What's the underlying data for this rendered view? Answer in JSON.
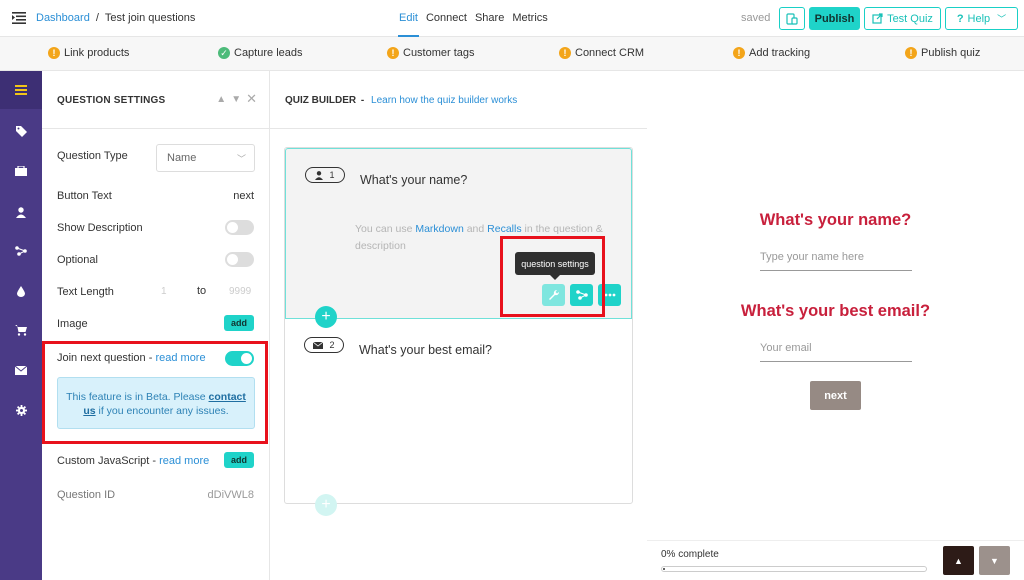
{
  "topbar": {
    "breadcrumb_root": "Dashboard",
    "breadcrumb_sep": "/",
    "breadcrumb_current": "Test join questions",
    "nav": [
      "Edit",
      "Connect",
      "Share",
      "Metrics"
    ],
    "saved": "saved",
    "publish": "Publish",
    "test_quiz": "Test Quiz",
    "help": "Help"
  },
  "checklist": [
    "Link products",
    "Capture leads",
    "Customer tags",
    "Connect CRM",
    "Add tracking",
    "Publish quiz"
  ],
  "settings": {
    "title": "QUESTION SETTINGS",
    "question_type_label": "Question Type",
    "question_type_value": "Name",
    "button_text_label": "Button Text",
    "button_text_value": "next",
    "show_description_label": "Show Description",
    "optional_label": "Optional",
    "text_length_label": "Text Length",
    "text_length_min": "1",
    "text_length_to": "to",
    "text_length_max": "9999",
    "image_label": "Image",
    "add": "add",
    "join_next_label": "Join next question -",
    "read_more": "read more",
    "beta_text_1": "This feature is in Beta. Please",
    "beta_link": "contact",
    "beta_link_2": "us",
    "beta_text_2": "if you encounter any issues.",
    "custom_js_label": "Custom JavaScript -",
    "question_id_label": "Question ID",
    "question_id_value": "dDiVWL8"
  },
  "builder": {
    "title": "QUIZ BUILDER",
    "dash": "-",
    "learn_link": "Learn how the quiz builder works",
    "q1_number": "1",
    "q1_text": "What's your name?",
    "q1_desc_1": "You can use",
    "q1_desc_markdown": "Markdown",
    "q1_desc_and": "and",
    "q1_desc_recalls": "Recalls",
    "q1_desc_2": "in the question & description",
    "tooltip": "question settings",
    "q2_number": "2",
    "q2_text": "What's your best email?"
  },
  "preview": {
    "q1": "What's your name?",
    "q1_placeholder": "Type your name here",
    "q2": "What's your best email?",
    "q2_placeholder": "Your email",
    "next": "next",
    "progress_text": "0% complete",
    "progress": 0.0
  },
  "colors": {
    "accent": "#1fd3c9",
    "rail": "#4a3a86",
    "preview_question": "#c8203c",
    "highlight": "#e8111c",
    "link": "#2b8fd6"
  }
}
